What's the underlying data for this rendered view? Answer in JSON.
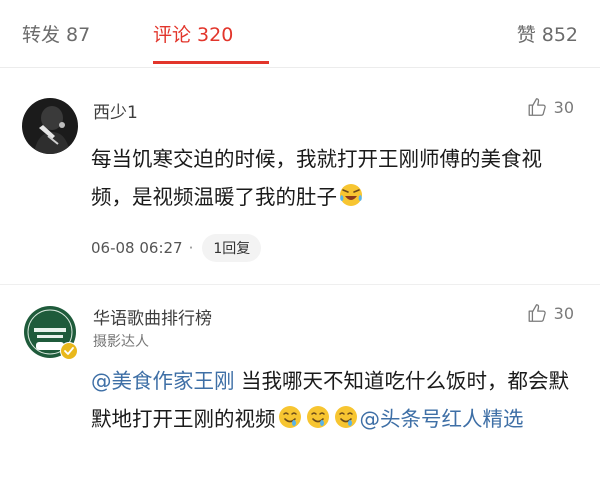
{
  "tabs": {
    "repost": "转发 87",
    "comments": "评论 320",
    "likes": "赞 852"
  },
  "comments": [
    {
      "username": "西少1",
      "like_count": "30",
      "text": "每当饥寒交迫的时候，我就打开王刚师傅的美食视频，是视频温暖了我的肚子",
      "emoji_icon": "laughing-tears-emoji",
      "timestamp": "06-08 06:27",
      "separator": "·",
      "reply_label": "1回复"
    },
    {
      "username": "华语歌曲排行榜",
      "role": "摄影达人",
      "like_count": "30",
      "mention_1": "@美食作家王刚",
      "text_1": " 当我哪天不知道吃什么饭时，都会默默地打开王刚的视频",
      "emoji_icon": "drooling-face-emoji",
      "at_symbol": "@",
      "mention_2": "头条号红人精选"
    }
  ],
  "colors": {
    "accent": "#e2352b",
    "mention": "#3e6fa6",
    "verified_badge": "#e9b81c"
  }
}
